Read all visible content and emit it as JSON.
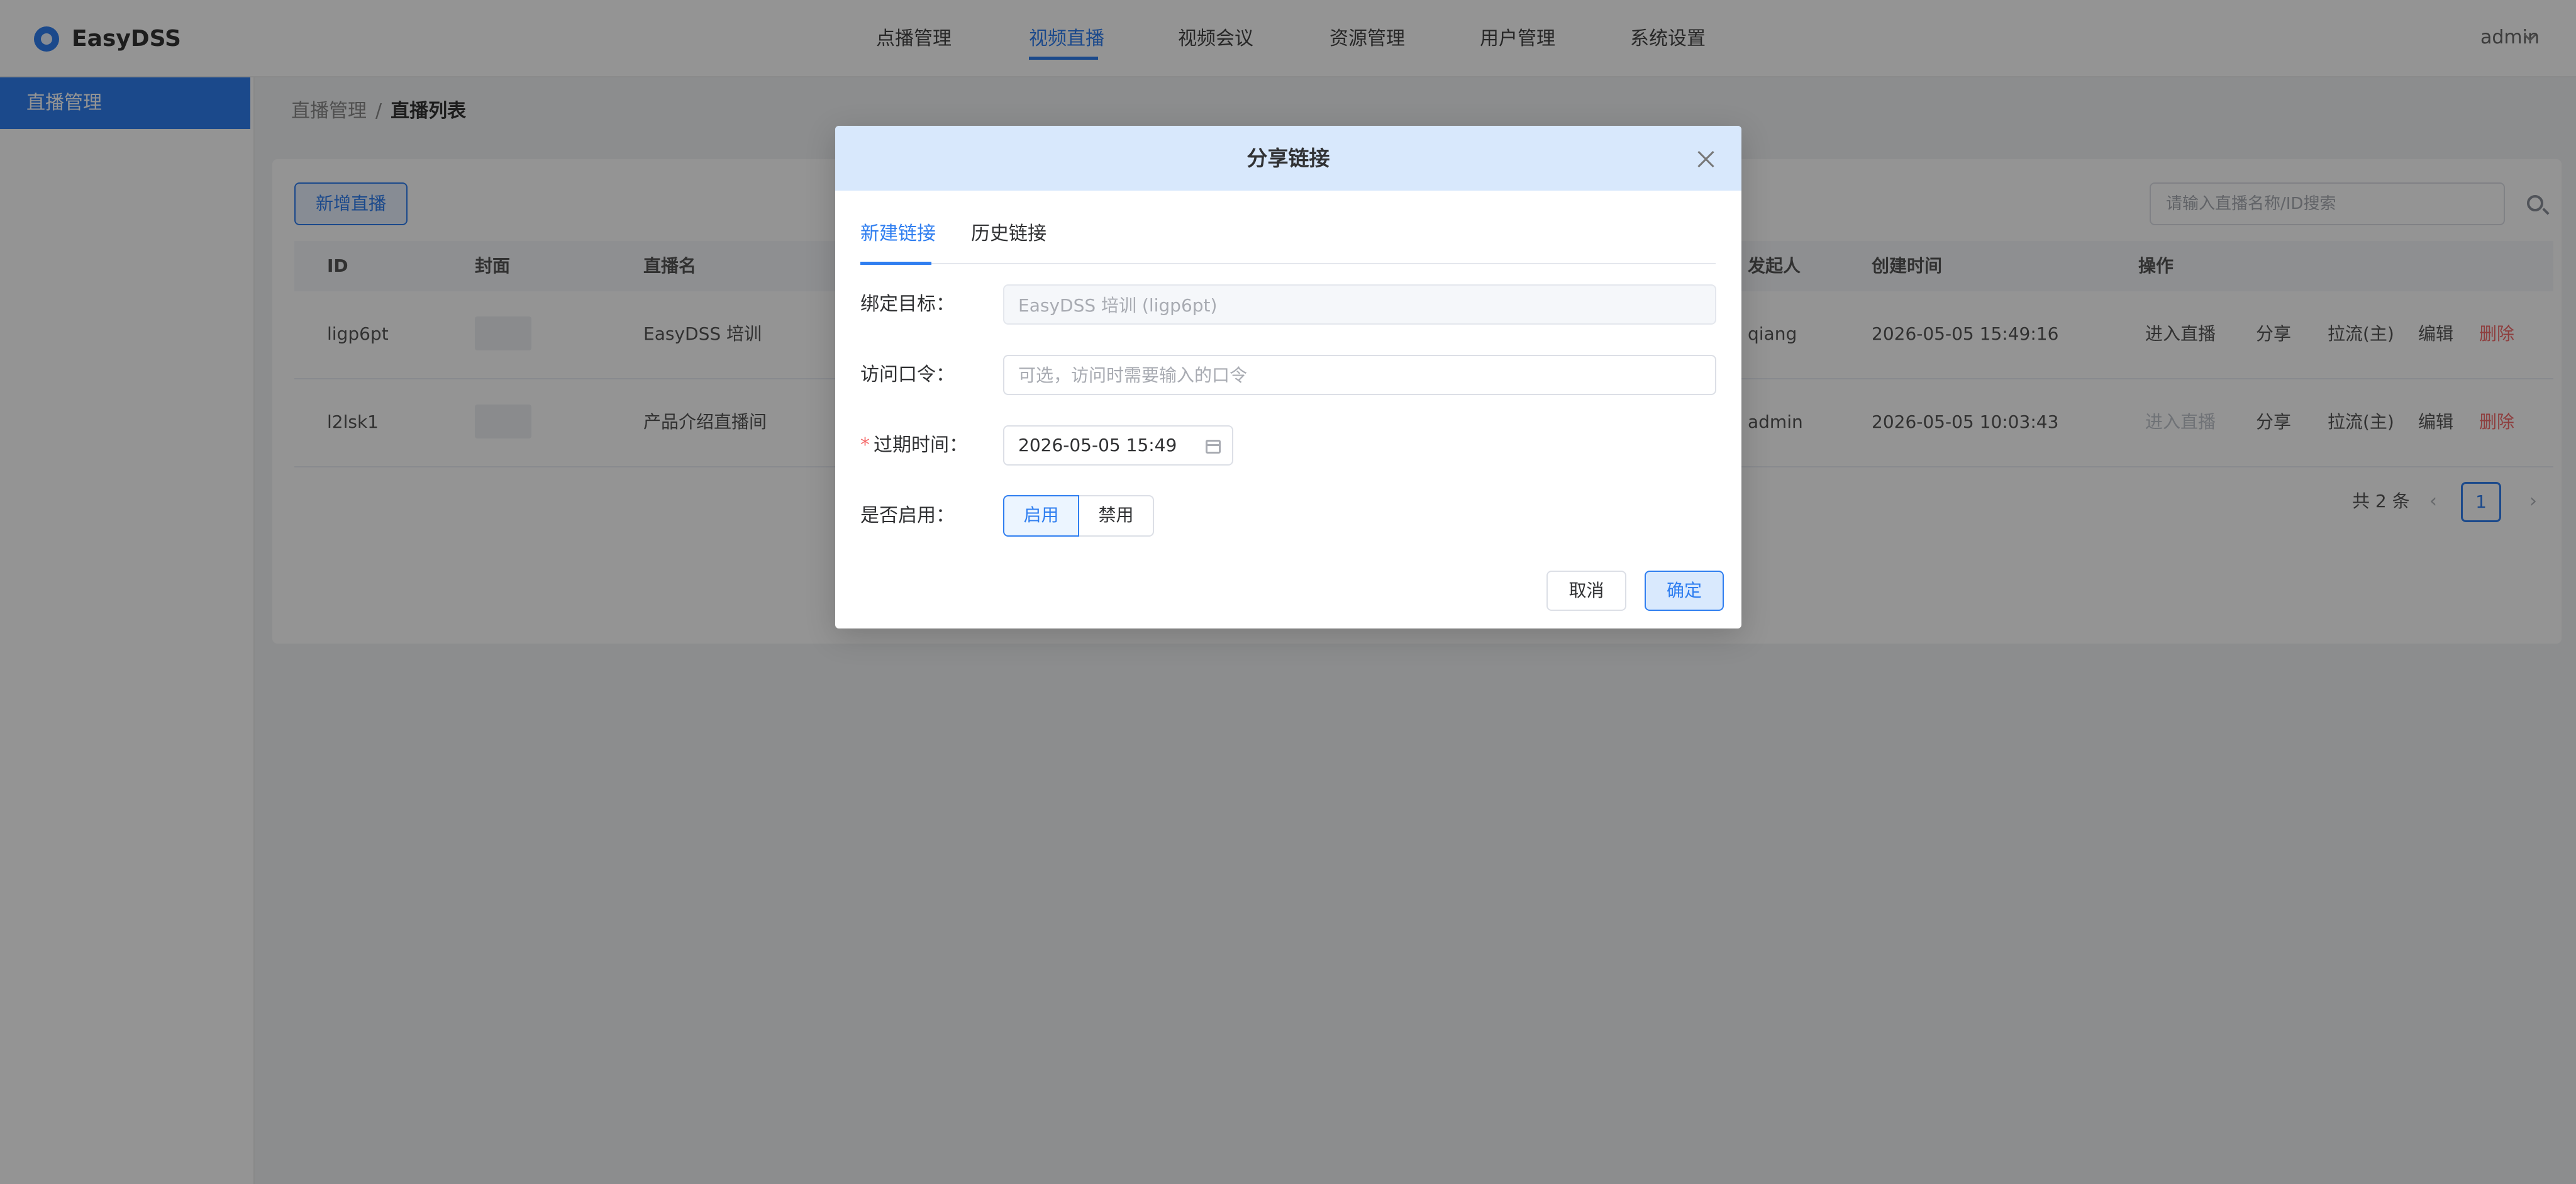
{
  "app": {
    "name": "EasyDSS",
    "user": "admin"
  },
  "nav": {
    "items": [
      "点播管理",
      "视频直播",
      "视频会议",
      "资源管理",
      "用户管理",
      "系统设置"
    ],
    "active": "视频直播"
  },
  "sidebar": {
    "items": [
      {
        "label": "直播管理"
      }
    ]
  },
  "breadcrumb": {
    "parent": "直播管理",
    "separator": "/",
    "current": "直播列表"
  },
  "toolbar": {
    "add_label": "新增直播",
    "search_placeholder": "请输入直播名称/ID搜索"
  },
  "table": {
    "headers": [
      "ID",
      "封面",
      "直播名",
      "发起人",
      "创建时间",
      "操作"
    ],
    "rows": [
      {
        "id": "ligp6pt",
        "name": "EasyDSS 培训",
        "creator": "qiang",
        "created": "2026-05-05 15:49:16",
        "actions": [
          "进入直播",
          "分享",
          "拉流(主)",
          "编辑",
          "删除"
        ]
      },
      {
        "id": "l2lsk1",
        "name": "产品介绍直播间",
        "creator": "admin",
        "created": "2026-05-05 10:03:43",
        "actions": [
          "进入直播",
          "分享",
          "拉流(主)",
          "编辑",
          "删除"
        ]
      }
    ]
  },
  "pagination": {
    "total": "共 2 条",
    "prev": "‹",
    "current": "1",
    "next": "›"
  },
  "dialog": {
    "title": "分享链接",
    "tabs": [
      "新建链接",
      "历史链接"
    ],
    "active_tab": "新建链接",
    "fields": {
      "target": {
        "label": "绑定目标：",
        "value": "EasyDSS 培训 (ligp6pt)"
      },
      "password": {
        "label": "访问口令：",
        "value": "",
        "placeholder": "可选，访问时需要输入的口令"
      },
      "expire": {
        "required_mark": "*",
        "label": "过期时间：",
        "value": "2026-05-05 15:49"
      },
      "enabled": {
        "label": "是否启用：",
        "options": [
          "启用",
          "禁用"
        ],
        "selected": "启用"
      }
    },
    "cancel_label": "取消",
    "confirm_label": "确定"
  },
  "icons": {
    "close": "close-icon",
    "calendar": "calendar-icon",
    "search": "search-icon",
    "logo": "logo-icon"
  },
  "colors": {
    "primary": "#2f7ef0",
    "danger": "#f56c6c",
    "dialog_header": "#d8e8fc",
    "overlay": "rgba(0,0,0,0.42)"
  }
}
